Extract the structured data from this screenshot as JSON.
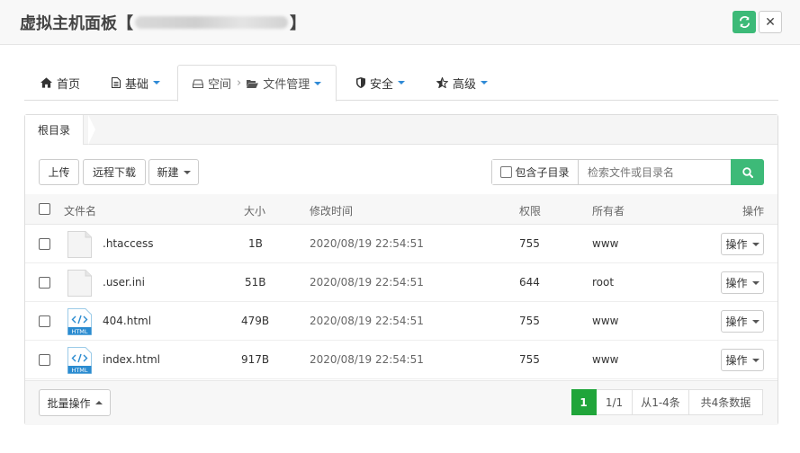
{
  "header": {
    "title_prefix": "虚拟主机面板【",
    "title_suffix": "】"
  },
  "tabs": [
    {
      "icon": "home-icon",
      "label": "首页"
    },
    {
      "icon": "document-icon",
      "label": "基础"
    },
    {
      "icon": "drive-icon",
      "label": "空间",
      "sub_label": "文件管理"
    },
    {
      "icon": "shield-icon",
      "label": "安全"
    },
    {
      "icon": "star-icon",
      "label": "高级"
    }
  ],
  "breadcrumb": {
    "root": "根目录"
  },
  "toolbar": {
    "upload": "上传",
    "remote_download": "远程下载",
    "new": "新建",
    "include_subdir": "包含子目录",
    "search_placeholder": "检索文件或目录名"
  },
  "table": {
    "headers": {
      "name": "文件名",
      "size": "大小",
      "mtime": "修改时间",
      "perm": "权限",
      "owner": "所有者",
      "ops": "操作"
    },
    "rows": [
      {
        "name": ".htaccess",
        "type": "file",
        "size": "1B",
        "mtime": "2020/08/19 22:54:51",
        "perm": "755",
        "owner": "www",
        "op": "操作"
      },
      {
        "name": ".user.ini",
        "type": "file",
        "size": "51B",
        "mtime": "2020/08/19 22:54:51",
        "perm": "644",
        "owner": "root",
        "op": "操作"
      },
      {
        "name": "404.html",
        "type": "html",
        "size": "479B",
        "mtime": "2020/08/19 22:54:51",
        "perm": "755",
        "owner": "www",
        "op": "操作"
      },
      {
        "name": "index.html",
        "type": "html",
        "size": "917B",
        "mtime": "2020/08/19 22:54:51",
        "perm": "755",
        "owner": "www",
        "op": "操作"
      }
    ],
    "html_badge": "HTML"
  },
  "footer": {
    "batch": "批量操作",
    "page_current": "1",
    "page_total": "1/1",
    "range": "从1-4条",
    "count": "共4条数据"
  },
  "colors": {
    "accent": "#20a53a",
    "refresh": "#3dba78",
    "link": "#2f8ad6"
  }
}
